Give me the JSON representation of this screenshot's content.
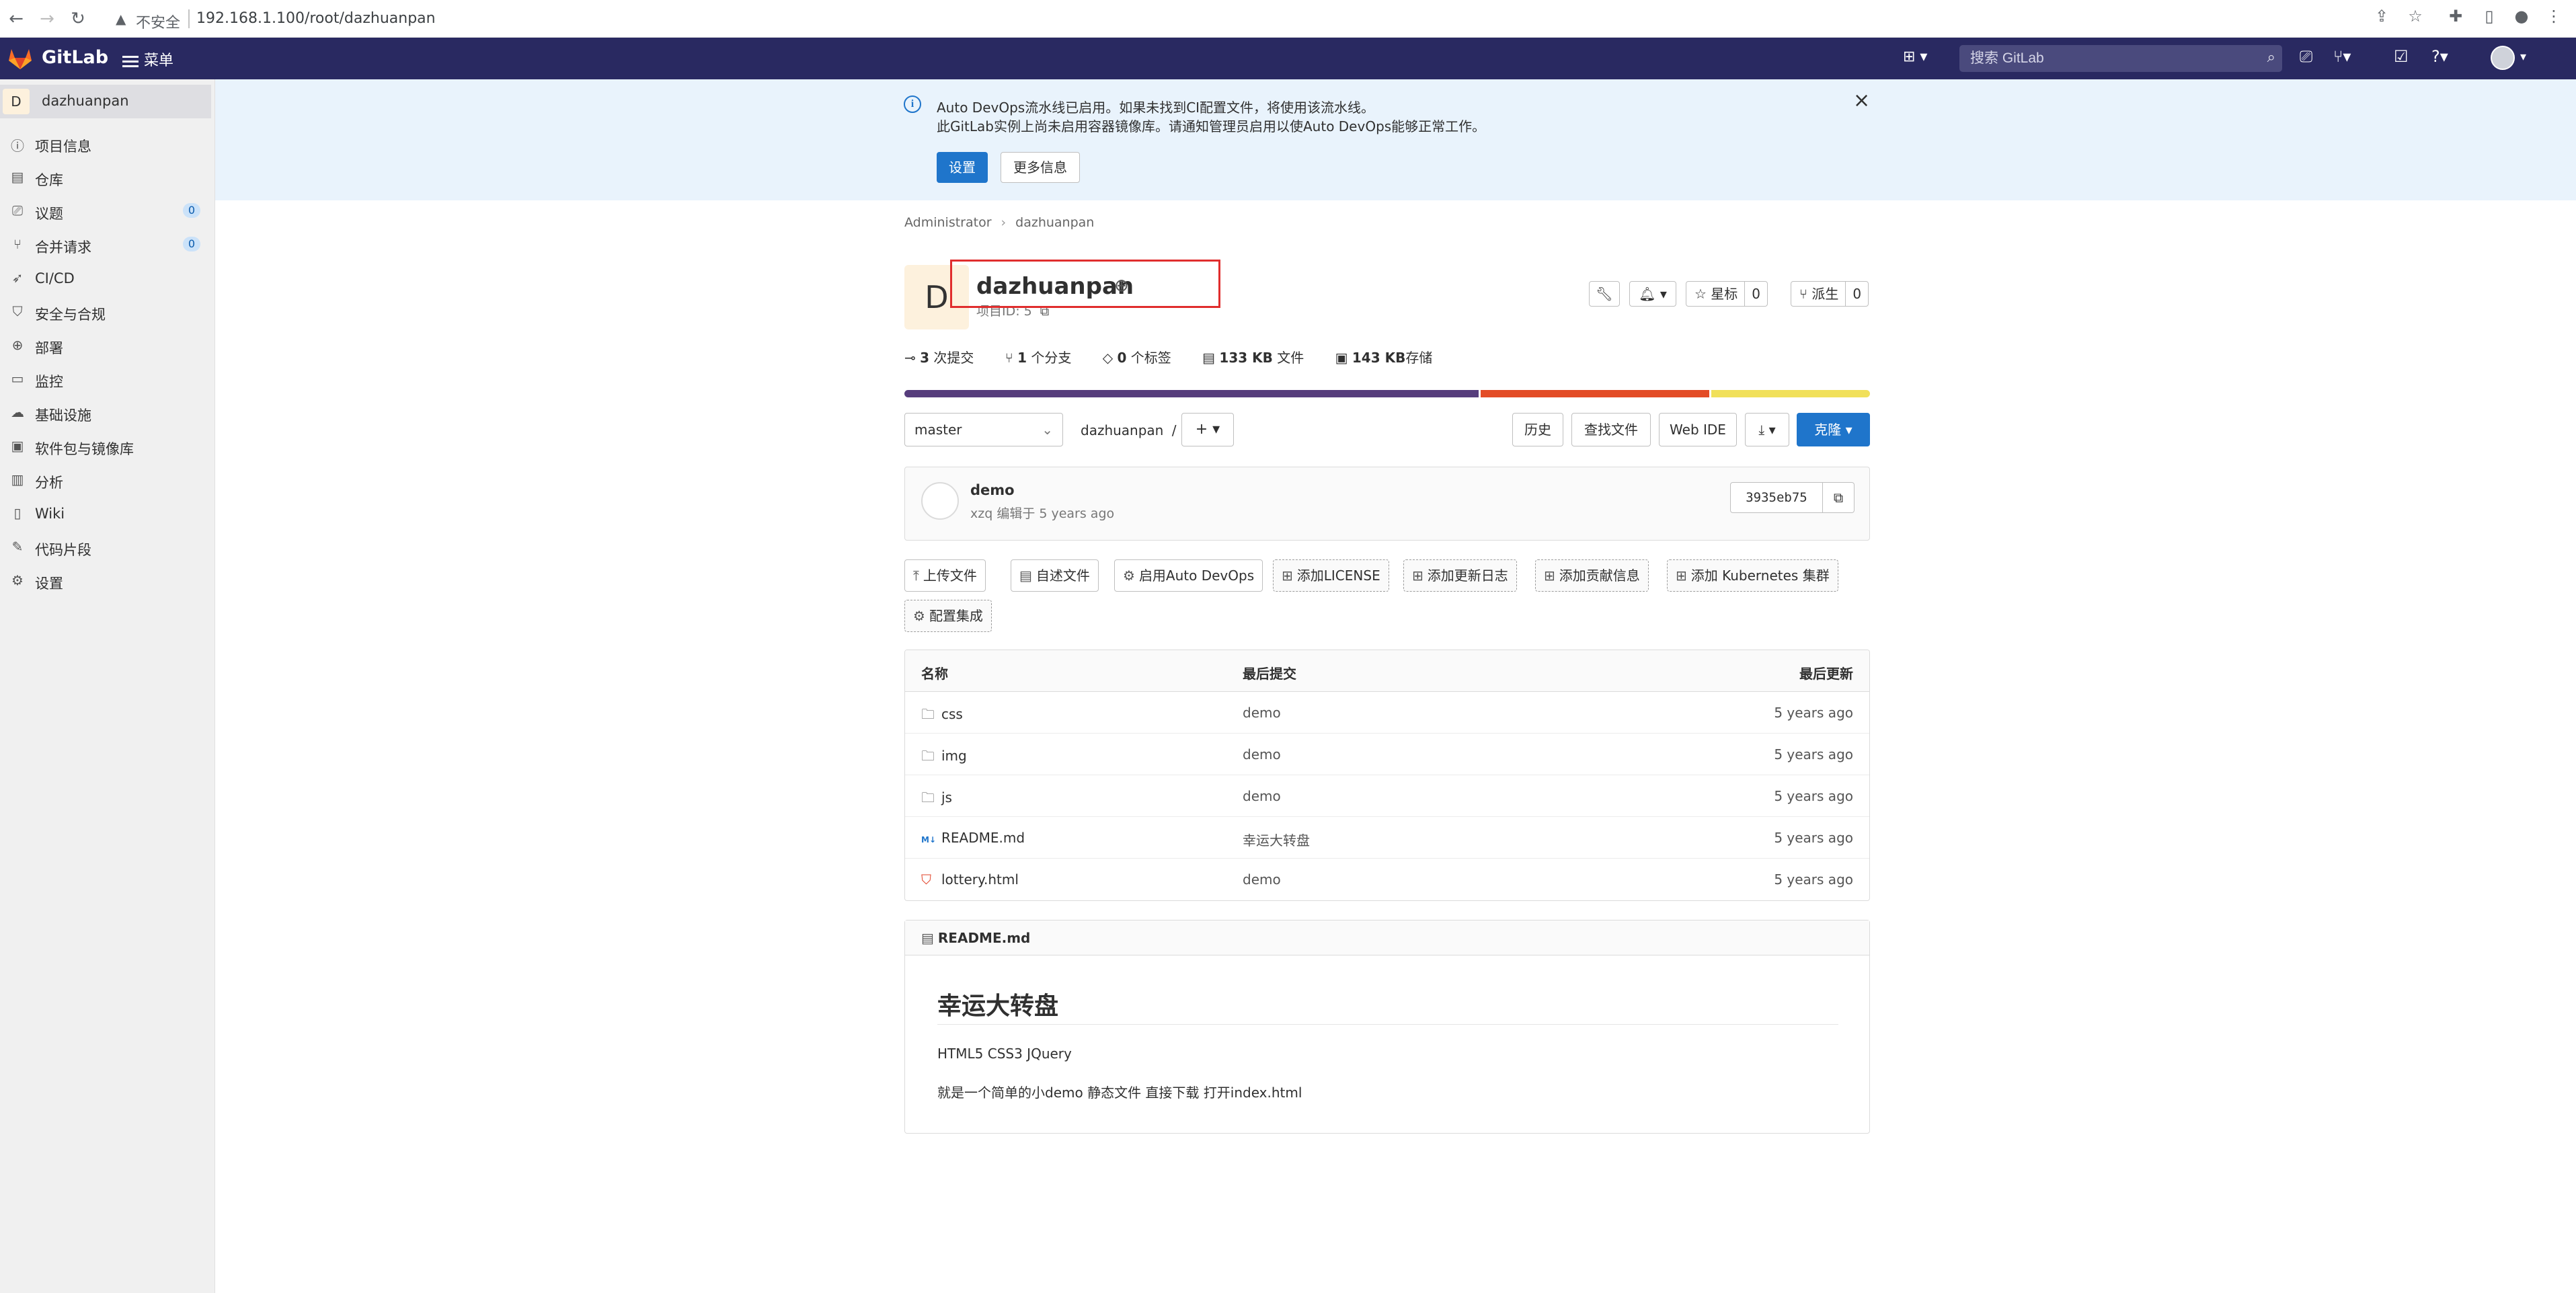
{
  "browser": {
    "insecure_label": "不安全",
    "url": "192.168.1.100/root/dazhuanpan"
  },
  "header": {
    "brand": "GitLab",
    "menu_label": "菜单",
    "search_placeholder": "搜索 GitLab",
    "bg_color": "#292961"
  },
  "sidebar": {
    "project_initial": "D",
    "project_name": "dazhuanpan",
    "items": [
      {
        "label": "项目信息",
        "icon": "info-icon"
      },
      {
        "label": "仓库",
        "icon": "doc-icon"
      },
      {
        "label": "议题",
        "icon": "issues-icon",
        "count": "0"
      },
      {
        "label": "合并请求",
        "icon": "merge-request-icon",
        "count": "0"
      },
      {
        "label": "CI/CD",
        "icon": "rocket-icon"
      },
      {
        "label": "安全与合规",
        "icon": "shield-icon"
      },
      {
        "label": "部署",
        "icon": "deploy-icon"
      },
      {
        "label": "监控",
        "icon": "monitor-icon"
      },
      {
        "label": "基础设施",
        "icon": "cloud-icon"
      },
      {
        "label": "软件包与镜像库",
        "icon": "package-icon"
      },
      {
        "label": "分析",
        "icon": "chart-icon"
      },
      {
        "label": "Wiki",
        "icon": "book-icon"
      },
      {
        "label": "代码片段",
        "icon": "snippet-icon"
      },
      {
        "label": "设置",
        "icon": "gear-icon"
      }
    ]
  },
  "banner": {
    "line1": "Auto DevOps流水线已启用。如果未找到CI配置文件，将使用该流水线。",
    "line2": "此GitLab实例上尚未启用容器镜像库。请通知管理员启用以使Auto DevOps能够正常工作。",
    "settings_button": "设置",
    "more_info_button": "更多信息"
  },
  "breadcrumb": {
    "items": [
      "Administrator",
      "dazhuanpan"
    ]
  },
  "project": {
    "initial": "D",
    "title": "dazhuanpan",
    "id_label": "项目ID: 5",
    "star_label": "星标",
    "star_count": "0",
    "fork_label": "派生",
    "fork_count": "0"
  },
  "stats": {
    "commits_n": "3",
    "commits_label": "次提交",
    "branches_n": "1",
    "branches_label": "个分支",
    "tags_n": "0",
    "tags_label": "个标签",
    "files_n": "133 KB",
    "files_label": "文件",
    "storage_n": "143 KB",
    "storage_label": "存储"
  },
  "languages": [
    {
      "color": "#563d7c",
      "share": 0.597
    },
    {
      "color": "#e34c26",
      "share": 0.238
    },
    {
      "color": "#f1e05a",
      "share": 0.165
    }
  ],
  "toolbar": {
    "branch": "master",
    "path": "dazhuanpan",
    "path_sep": "/",
    "history": "历史",
    "find_file": "查找文件",
    "web_ide": "Web IDE",
    "clone": "克隆"
  },
  "last_commit": {
    "message": "demo",
    "author_line": "xzq 编辑于 5 years ago",
    "sha": "3935eb75"
  },
  "quick_actions": [
    "上传文件",
    "自述文件",
    "启用Auto DevOps",
    "添加LICENSE",
    "添加更新日志",
    "添加贡献信息",
    "添加 Kubernetes 集群",
    "配置集成"
  ],
  "file_tree": {
    "headers": [
      "名称",
      "最后提交",
      "最后更新"
    ],
    "rows": [
      {
        "name": "css",
        "type": "folder",
        "commit": "demo",
        "updated": "5 years ago"
      },
      {
        "name": "img",
        "type": "folder",
        "commit": "demo",
        "updated": "5 years ago"
      },
      {
        "name": "js",
        "type": "folder",
        "commit": "demo",
        "updated": "5 years ago"
      },
      {
        "name": "README.md",
        "type": "md",
        "commit": "幸运大转盘",
        "updated": "5 years ago"
      },
      {
        "name": "lottery.html",
        "type": "html",
        "commit": "demo",
        "updated": "5 years ago"
      }
    ]
  },
  "readme": {
    "filename": "README.md",
    "heading": "幸运大转盘",
    "para1": "HTML5 CSS3 JQuery",
    "para2": "就是一个简单的小demo 静态文件 直接下载 打开index.html"
  }
}
